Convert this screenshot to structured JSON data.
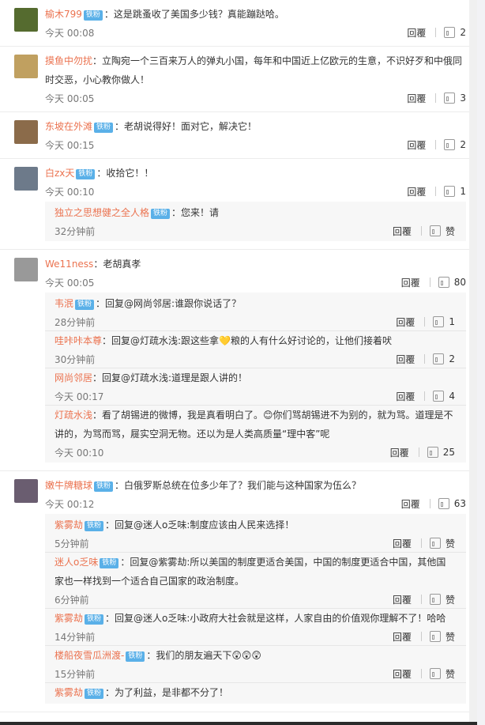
{
  "comments": [
    {
      "user": "榆木799",
      "badge": "铁粉",
      "text": "：这是跳蚤收了美国多少钱？真能蹦跶哈。",
      "time": "今天 00:08",
      "reply": "回覆",
      "likes": "2",
      "avatar_color": "#556b2f"
    },
    {
      "user": "摸鱼中勿扰",
      "badge": "",
      "text": "：立陶宛一个三百来万人的弹丸小国，每年和中国近上亿欧元的生意，不识好歹和中俄同时交恶，小心教你做人！",
      "time": "今天 00:05",
      "reply": "回覆",
      "likes": "3",
      "avatar_color": "#c0a060"
    },
    {
      "user": "东坡在外滩",
      "badge": "铁粉",
      "text": "：老胡说得好！面对它，解决它！",
      "time": "今天 00:15",
      "reply": "回覆",
      "likes": "2",
      "avatar_color": "#8b6b4a"
    },
    {
      "user": "白zx天",
      "badge": "铁粉",
      "text": "：收拾它！！",
      "time": "今天 00:10",
      "reply": "回覆",
      "likes": "1",
      "avatar_color": "#6d7a8a",
      "replies": [
        {
          "user": "独立之思想健之全人格",
          "badge": "铁粉",
          "text": "：您来！请",
          "time": "32分钟前",
          "reply": "回覆",
          "likes": "赞"
        }
      ]
    },
    {
      "user": "We11ness",
      "badge": "",
      "text": "：老胡真孝",
      "time": "今天 00:05",
      "reply": "回覆",
      "likes": "80",
      "avatar_color": "#999999",
      "replies": [
        {
          "user": "韦泯",
          "badge": "铁粉",
          "text": "：回复@网尚邻居:谁跟你说话了？",
          "time": "28分钟前",
          "reply": "回覆",
          "likes": "1"
        },
        {
          "user": "哇咔咔本尊",
          "badge": "",
          "text": "：回复@灯疏水浅:跟这些拿💛粮的人有什么好讨论的，让他们接着吠",
          "time": "30分钟前",
          "reply": "回覆",
          "likes": "2"
        },
        {
          "user": "网尚邻居",
          "badge": "",
          "text": "：回复@灯疏水浅:道理是跟人讲的！",
          "time": "今天 00:17",
          "reply": "回覆",
          "likes": "4"
        },
        {
          "user": "灯疏水浅",
          "badge": "",
          "text": "：看了胡锡进的微博，我是真看明白了。😊你们骂胡锡进不为别的，就为骂。道理是不讲的，为骂而骂，屣实空洞无物。还以为是人类高质量“理中客”呢",
          "time": "今天 00:10",
          "reply": "回覆",
          "likes": "25"
        }
      ]
    },
    {
      "user": "嫩牛牌糖球",
      "badge": "铁粉",
      "text": "：白俄罗斯总统在位多少年了？我们能与这种国家为伍么？",
      "time": "今天 00:12",
      "reply": "回覆",
      "likes": "63",
      "avatar_color": "#6a5d70",
      "replies": [
        {
          "user": "紫雾劫",
          "badge": "铁粉",
          "text": "：回复@迷人o乏味:制度应该由人民来选择！",
          "time": "5分钟前",
          "reply": "回覆",
          "likes": "赞"
        },
        {
          "user": "迷人o乏味",
          "badge": "铁粉",
          "text": "：回复@紫雾劫:所以美国的制度更适合美国，中国的制度更适合中国，其他国家也一样找到一个适合自己国家的政治制度。",
          "time": "6分钟前",
          "reply": "回覆",
          "likes": "赞"
        },
        {
          "user": "紫雾劫",
          "badge": "铁粉",
          "text": "：回复@迷人o乏味:小政府大社会就是这样，人家自由的价值观你理解不了！哈哈",
          "time": "14分钟前",
          "reply": "回覆",
          "likes": "赞"
        },
        {
          "user": "楼船夜雪瓜洲渡-",
          "badge": "铁粉",
          "text": "：我们的朋友遍天下😲😲😲",
          "time": "15分钟前",
          "reply": "回覆",
          "likes": "赞"
        },
        {
          "user": "紫雾劫",
          "badge": "铁粉",
          "text": "：为了利益，是非都不分了！",
          "time": "",
          "reply": "",
          "likes": ""
        }
      ]
    }
  ]
}
